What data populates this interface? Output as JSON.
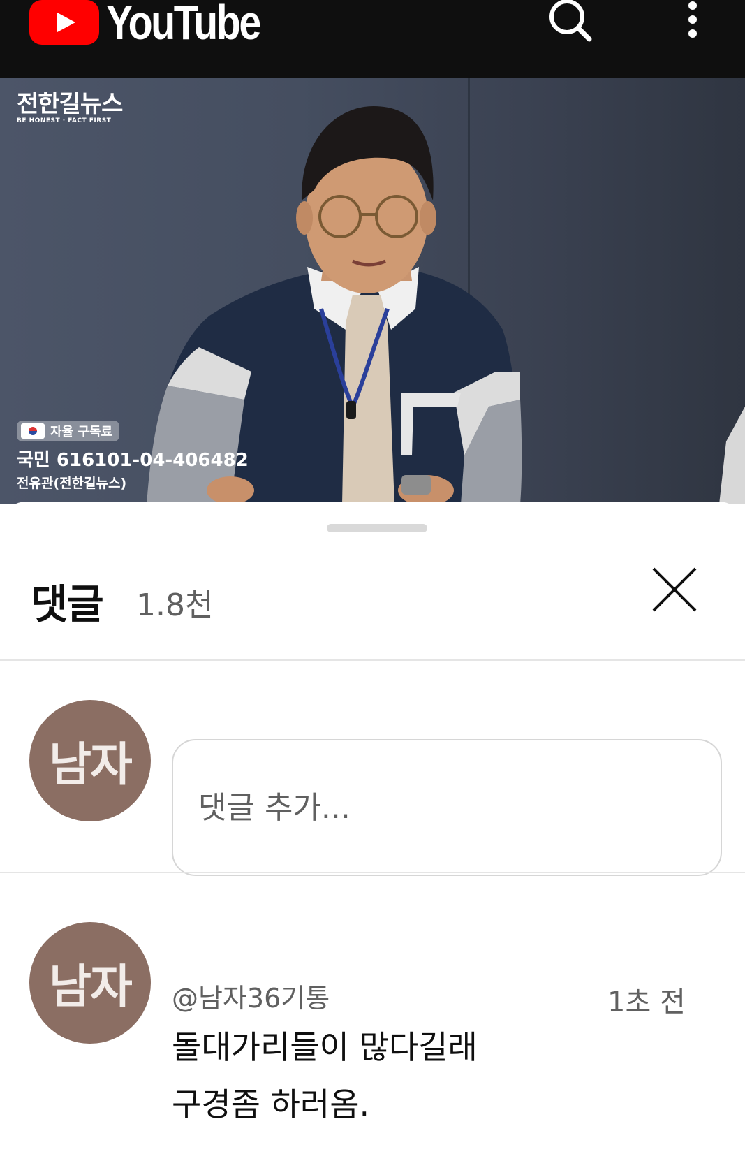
{
  "appbar": {
    "logo_text": "YouTube",
    "icons": [
      "youtube-logo",
      "search-icon",
      "more-vert-icon"
    ]
  },
  "video": {
    "channel_logo_name": "전한길뉴스",
    "channel_logo_tagline": "BE HONEST · FACT FIRST",
    "donation_label": "자율 구독료",
    "donation_account": "국민 616101-04-406482",
    "donation_holder": "전유관(전한길뉴스)"
  },
  "comments_sheet": {
    "title": "댓글",
    "count": "1.8천",
    "input_placeholder": "댓글 추가...",
    "user_avatar_text": "남자",
    "comments": [
      {
        "avatar_text": "남자",
        "author": "@남자36기통",
        "time": "1초 전",
        "text": "돌대가리들이 많다길래\n구경좀 하러옴."
      }
    ]
  },
  "colors": {
    "appbar_bg": "#0f0f0f",
    "brand_red": "#ff0000",
    "avatar_bg": "#8b6e63",
    "secondary_text": "#606060"
  }
}
